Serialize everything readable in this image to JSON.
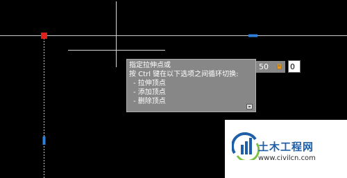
{
  "tooltip": {
    "lines": [
      "指定拉伸点或",
      "按 Ctrl 键在以下选项之间循环切换:",
      "- 拉伸顶点",
      "- 添加顶点",
      "- 删除顶点"
    ],
    "icon": "tooltip-toggle-icon"
  },
  "dynamic_input": {
    "length_value": "50",
    "lock_icon": "lock-icon",
    "angle_value": "0"
  },
  "watermark": {
    "title": "土木工程网",
    "url": "www.civilcn.com"
  },
  "colors": {
    "canvas_background": "#000000",
    "crosshair": "#d8d8d8",
    "grip_selected": "#e0201a",
    "grip_midpoint": "#2e7fd8",
    "tooltip_background": "#878787",
    "watermark_blue": "#1f5fa8"
  }
}
